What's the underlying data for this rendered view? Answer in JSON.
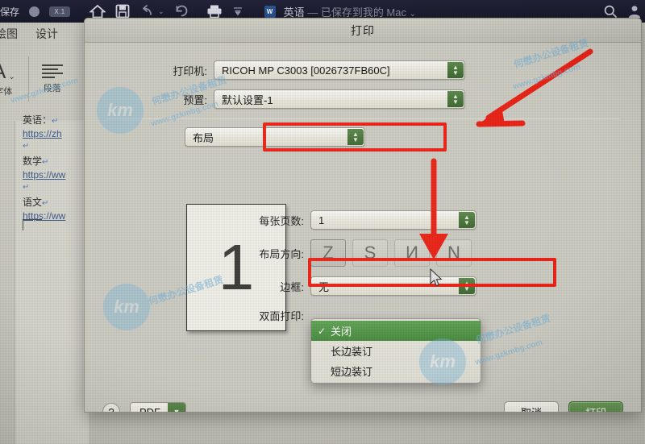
{
  "window": {
    "toolbar": {
      "save_label": "保存",
      "undo_icon": "undo-icon",
      "redo_icon": "redo-icon",
      "home_icon": "home-icon",
      "save_icon": "save-icon",
      "print_icon": "print-icon",
      "more_icon": "more-icon",
      "search_icon": "search-icon",
      "account_icon": "account-icon",
      "badge_label": "X.1",
      "doc_name": "英语",
      "doc_status": "— 已保存到我的 Mac"
    },
    "ribbon": {
      "tabs": [
        "绘图",
        "设计"
      ],
      "groups": [
        {
          "label": "字体",
          "icon": "font-icon"
        },
        {
          "label": "段落",
          "icon": "paragraph-icon"
        }
      ]
    },
    "document": {
      "lines": [
        {
          "text": "英语：",
          "type": "text"
        },
        {
          "text": "https://zh",
          "type": "link"
        },
        {
          "text": "数学",
          "type": "text"
        },
        {
          "text": "https://ww",
          "type": "link"
        },
        {
          "text": "语文",
          "type": "text"
        },
        {
          "text": "https://ww",
          "type": "link"
        }
      ],
      "pilcrow": "↵"
    }
  },
  "dialog": {
    "title": "打印",
    "printer": {
      "label": "打印机:",
      "value": "RICOH MP C3003 [0026737FB60C]"
    },
    "preset": {
      "label": "预置:",
      "value": "默认设置-1"
    },
    "pane": {
      "value": "布局"
    },
    "preview": {
      "page_number": "1"
    },
    "pages_per_sheet": {
      "label": "每张页数:",
      "value": "1"
    },
    "layout_direction": {
      "label": "布局方向:",
      "options": [
        "Z",
        "S",
        "И",
        "N"
      ],
      "selected_index": 0
    },
    "border": {
      "label": "边框:",
      "value": "无"
    },
    "two_sided": {
      "label": "双面打印:",
      "value": "关闭",
      "menu_open": true,
      "options": [
        {
          "label": "关闭",
          "checked": true,
          "highlighted": true
        },
        {
          "label": "长边装订",
          "checked": false,
          "highlighted": false
        },
        {
          "label": "短边装订",
          "checked": false,
          "highlighted": false
        }
      ]
    },
    "footer": {
      "help_label": "?",
      "pdf_label": "PDF",
      "pdf_chevron": "chevron-down-icon",
      "cancel_label": "取消",
      "print_label": "打印"
    }
  },
  "annotations": {
    "color": "#ee2317",
    "boxes": [
      {
        "name": "layout-popup-highlight"
      },
      {
        "name": "two-sided-row-highlight"
      }
    ],
    "arrows": [
      {
        "name": "arrow-to-layout-popup"
      },
      {
        "name": "arrow-to-two-sided"
      }
    ]
  },
  "watermarks": {
    "logo_text": "km",
    "site": "www.gzkmbg.com",
    "company": "何懋办公设备租赁"
  }
}
